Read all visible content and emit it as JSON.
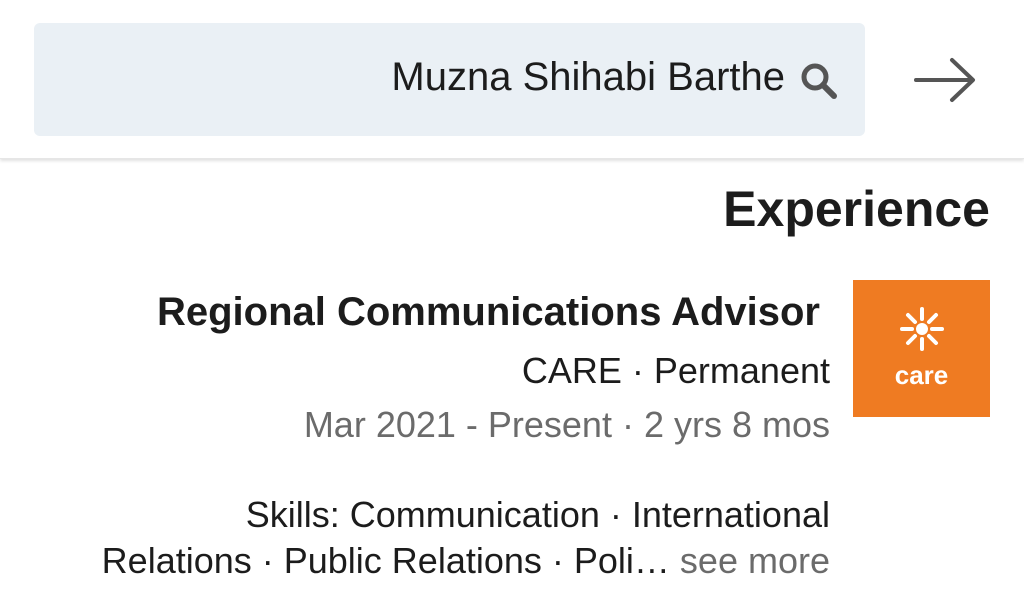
{
  "search": {
    "value": "Muzna Shihabi Barthe"
  },
  "icons": {
    "search": "search-icon",
    "forward": "arrow-right-icon"
  },
  "experience": {
    "section_title": "Experience",
    "job_title": "Regional Communications Advisor",
    "company_line": "CARE · Permanent",
    "date_line": "Mar 2021 - Present · 2 yrs 8 mos",
    "skills_line1": "Skills: Communication · International",
    "skills_line2": "Relations · Public Relations · Poli…",
    "see_more": "see more",
    "logo_text": "care"
  },
  "colors": {
    "logo_bg": "#ef7b22",
    "search_bg": "#eaf0f5",
    "text_primary": "#1c1c1c",
    "text_secondary": "#6b6b6b"
  }
}
